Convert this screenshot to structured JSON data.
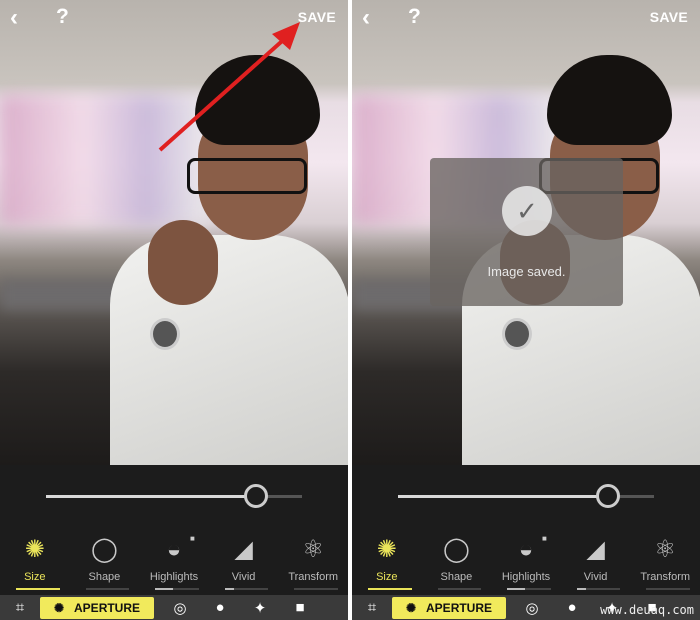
{
  "panels": [
    {
      "back_icon": "chevron-left-icon",
      "help_label": "?",
      "save_label": "SAVE",
      "slider_value": 0.82,
      "tools": [
        {
          "label": "Size",
          "icon": "aperture-icon",
          "level": 1.0,
          "selected": true
        },
        {
          "label": "Shape",
          "icon": "circle-icon",
          "level": 0
        },
        {
          "label": "Highlights",
          "icon": "highlights-icon",
          "level": 0.4,
          "locked": true
        },
        {
          "label": "Vivid",
          "icon": "paint-bucket-icon",
          "level": 0.2
        },
        {
          "label": "Transform",
          "icon": "atom-icon",
          "level": 0
        }
      ],
      "bottom_bar": {
        "aperture_label": "APERTURE",
        "icons": [
          "crop-icon",
          "aperture-icon",
          "lens-icon",
          "lightbulb-icon",
          "magic-wand-icon",
          "brush-icon"
        ]
      }
    },
    {
      "back_icon": "chevron-left-icon",
      "help_label": "?",
      "save_label": "SAVE",
      "slider_value": 0.82,
      "toast": {
        "message": "Image saved.",
        "icon": "checkmark-icon"
      },
      "tools": [
        {
          "label": "Size",
          "icon": "aperture-icon",
          "level": 1.0,
          "selected": true
        },
        {
          "label": "Shape",
          "icon": "circle-icon",
          "level": 0
        },
        {
          "label": "Highlights",
          "icon": "highlights-icon",
          "level": 0.4,
          "locked": true
        },
        {
          "label": "Vivid",
          "icon": "paint-bucket-icon",
          "level": 0.2
        },
        {
          "label": "Transform",
          "icon": "atom-icon",
          "level": 0
        }
      ],
      "bottom_bar": {
        "aperture_label": "APERTURE",
        "icons": [
          "crop-icon",
          "aperture-icon",
          "lens-icon",
          "lightbulb-icon",
          "magic-wand-icon",
          "brush-icon"
        ]
      }
    }
  ],
  "watermark": "www.deuaq.com",
  "colors": {
    "accent": "#f1ea5c",
    "arrow": "#e02020"
  }
}
